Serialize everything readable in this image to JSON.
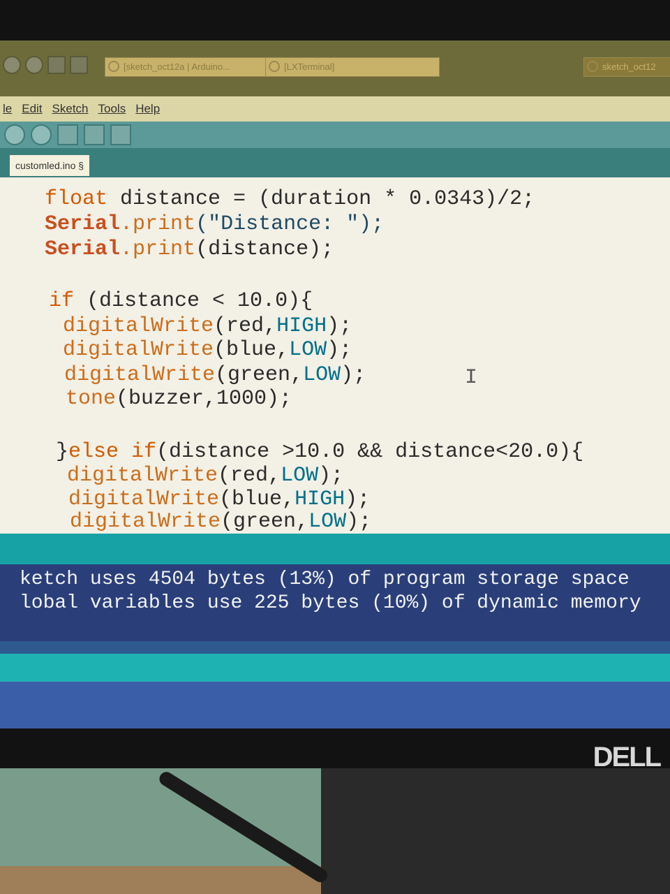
{
  "taskbar": {
    "tasks": [
      {
        "label": "[sketch_oct12a | Arduino..."
      },
      {
        "label": "[LXTerminal]"
      },
      {
        "label": "sketch_oct12"
      }
    ]
  },
  "menubar": {
    "items": [
      "le",
      "Edit",
      "Sketch",
      "Tools",
      "Help"
    ]
  },
  "editor": {
    "tab_label": "customled.ino §",
    "lines": [
      {
        "pre": "",
        "ser": "",
        "kw": "float",
        "rest": " distance = (duration * 0.0343)/2;"
      },
      {
        "ser": "Serial",
        "fn": ".print",
        "rest": "(\"Distance: \");"
      },
      {
        "ser": "Serial",
        "fn": ".print",
        "rest": "(distance);"
      },
      {
        "kw": "if",
        "rest": " (distance < 10.0){"
      },
      {
        "fn": "digitalWrite",
        "a": "(red,",
        "c": "HIGH",
        "b": ");"
      },
      {
        "fn": "digitalWrite",
        "a": "(blue,",
        "c": "LOW",
        "b": ");"
      },
      {
        "fn": "digitalWrite",
        "a": "(green,",
        "c": "LOW",
        "b": ");"
      },
      {
        "fn": "tone",
        "a": "(buzzer,1000);"
      },
      {
        "b0": "}",
        "kw": "else if",
        "rest": "(distance >10.0 && distance<20.0){"
      },
      {
        "fn": "digitalWrite",
        "a": "(red,",
        "c": "LOW",
        "b": ");"
      },
      {
        "fn": "digitalWrite",
        "a": "(blue,",
        "c": "HIGH",
        "b": ");"
      },
      {
        "fn": "digitalWrite",
        "a": "(green,",
        "c": "LOW",
        "b": ");"
      }
    ]
  },
  "console": {
    "line1": "ketch uses 4504 bytes (13%) of program storage space",
    "line2": "lobal variables use 225 bytes (10%) of dynamic memory"
  },
  "brand": "DELL"
}
